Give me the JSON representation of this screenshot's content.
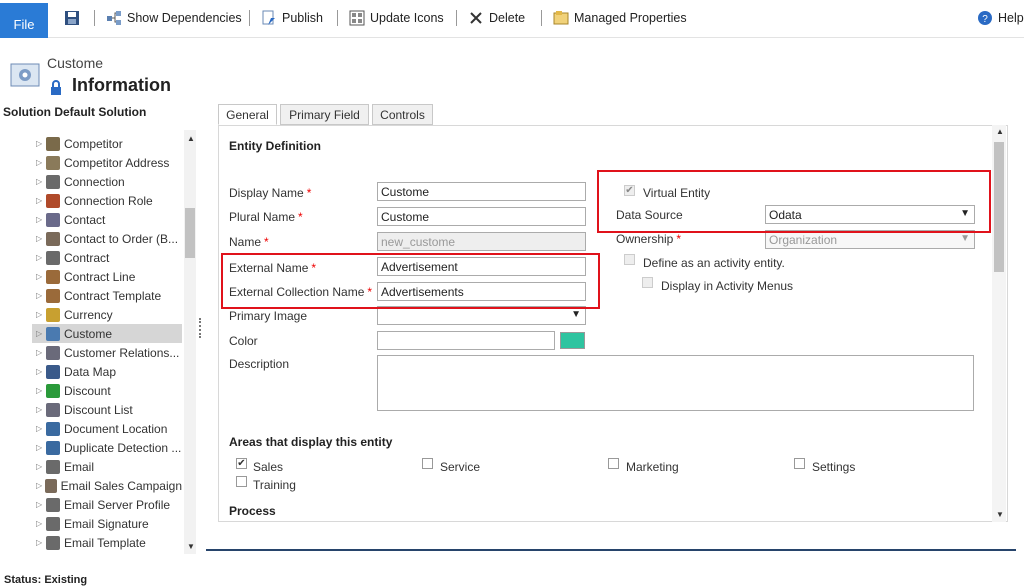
{
  "ribbon": {
    "file": "File",
    "show_dependencies": "Show Dependencies",
    "publish": "Publish",
    "update_icons": "Update Icons",
    "delete": "Delete",
    "managed_properties": "Managed Properties",
    "help": "Help"
  },
  "header": {
    "entity_name": "Custome",
    "title": "Information",
    "solution_label": "Solution Default Solution"
  },
  "tree": {
    "items": [
      {
        "label": "Competitor"
      },
      {
        "label": "Competitor Address"
      },
      {
        "label": "Connection"
      },
      {
        "label": "Connection Role"
      },
      {
        "label": "Contact"
      },
      {
        "label": "Contact to Order (B..."
      },
      {
        "label": "Contract"
      },
      {
        "label": "Contract Line"
      },
      {
        "label": "Contract Template"
      },
      {
        "label": "Currency"
      },
      {
        "label": "Custome"
      },
      {
        "label": "Customer Relations..."
      },
      {
        "label": "Data Map"
      },
      {
        "label": "Discount"
      },
      {
        "label": "Discount List"
      },
      {
        "label": "Document Location"
      },
      {
        "label": "Duplicate Detection ..."
      },
      {
        "label": "Email"
      },
      {
        "label": "Email Sales Campaign"
      },
      {
        "label": "Email Server Profile"
      },
      {
        "label": "Email Signature"
      },
      {
        "label": "Email Template"
      }
    ]
  },
  "tabs": {
    "general": "General",
    "primary_field": "Primary Field",
    "controls": "Controls"
  },
  "form": {
    "entity_definition": "Entity Definition",
    "display_name_label": "Display Name",
    "display_name_value": "Custome",
    "plural_name_label": "Plural Name",
    "plural_name_value": "Custome",
    "name_label": "Name",
    "name_value": "new_custome",
    "external_name_label": "External Name",
    "external_name_value": "Advertisement",
    "external_collection_label": "External Collection Name",
    "external_collection_value": "Advertisements",
    "primary_image_label": "Primary Image",
    "color_label": "Color",
    "color_value": "#2ec4a0",
    "description_label": "Description",
    "virtual_entity_label": "Virtual Entity",
    "data_source_label": "Data Source",
    "data_source_value": "Odata",
    "ownership_label": "Ownership",
    "ownership_value": "Organization",
    "activity_label": "Define as an activity entity.",
    "activity_menus_label": "Display in Activity Menus",
    "areas_heading": "Areas that display this entity",
    "area_sales": "Sales",
    "area_service": "Service",
    "area_marketing": "Marketing",
    "area_settings": "Settings",
    "area_training": "Training",
    "process_heading": "Process",
    "required_mark": "*",
    "checked_mark": "✔"
  },
  "status": "Status: Existing",
  "colors": {
    "accent": "#2a7bd6",
    "highlight": "#e0121b"
  }
}
